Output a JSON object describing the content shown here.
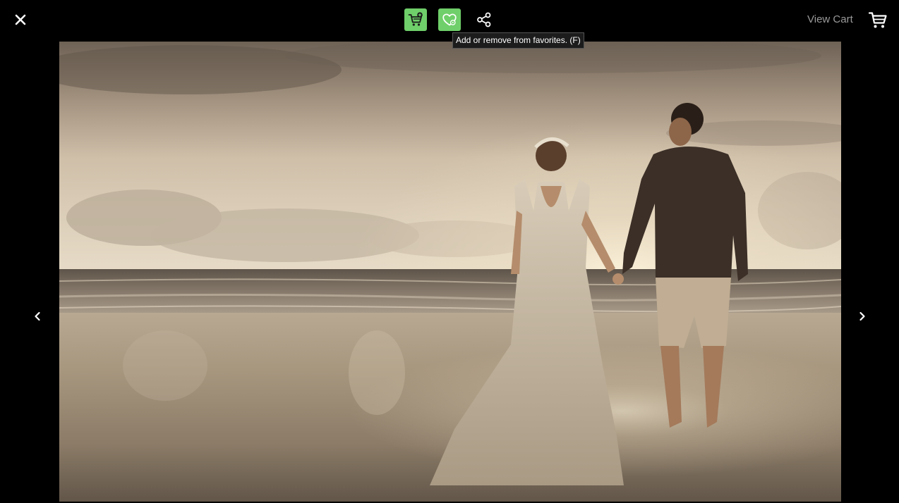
{
  "toolbar": {
    "close_icon": "close-icon",
    "add_to_cart_icon": "cart-plus-icon",
    "favorite_icon": "heart-icon",
    "share_icon": "share-icon",
    "favorite_tooltip": "Add or remove from favorites. (F)",
    "view_cart_label": "View Cart",
    "view_cart_icon": "cart-icon",
    "accent_color": "#6fcf6a"
  },
  "viewer": {
    "prev_icon": "chevron-left-icon",
    "next_icon": "chevron-right-icon",
    "photo_subject": "photo"
  }
}
